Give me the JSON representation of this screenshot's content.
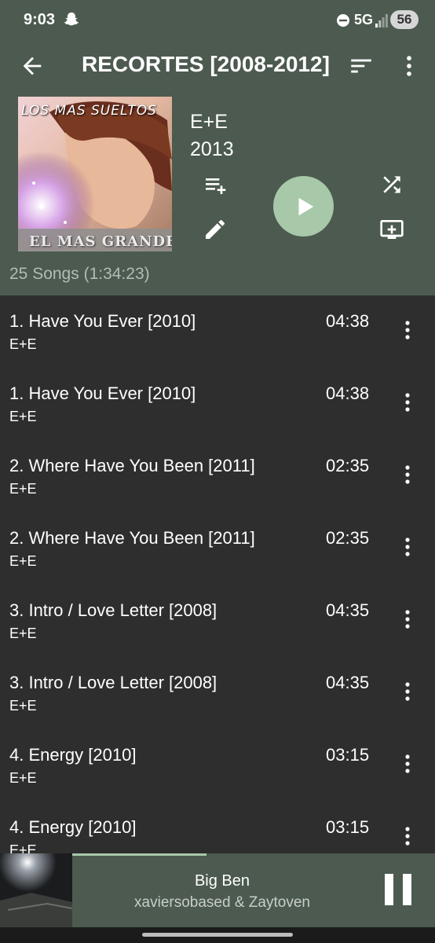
{
  "status_bar": {
    "time": "9:03",
    "network": "5G",
    "battery": "56",
    "icons": [
      "snapchat-icon",
      "do-not-disturb-icon",
      "signal-icon"
    ]
  },
  "toolbar": {
    "title": "RECORTES [2008-2012]",
    "icons": [
      "back-arrow-icon",
      "sort-icon",
      "more-vert-icon"
    ]
  },
  "album": {
    "art_text_top": "LOS MAS SUELTOS",
    "art_text_bottom": "EL MAS GRANDE",
    "artist": "E+E",
    "year": "2013",
    "song_count": "25 Songs (1:34:23)",
    "actions": [
      "add-to-queue-icon",
      "edit-icon",
      "play-icon",
      "shuffle-icon",
      "cast-icon"
    ]
  },
  "songs": [
    {
      "title": "1. Have You Ever [2010]",
      "artist": "E+E",
      "duration": "04:38"
    },
    {
      "title": "1. Have You Ever [2010]",
      "artist": "E+E",
      "duration": "04:38"
    },
    {
      "title": "2. Where Have You Been [2011]",
      "artist": "E+E",
      "duration": "02:35"
    },
    {
      "title": "2. Where Have You Been [2011]",
      "artist": "E+E",
      "duration": "02:35"
    },
    {
      "title": "3. Intro / Love Letter [2008]",
      "artist": "E+E",
      "duration": "04:35"
    },
    {
      "title": "3. Intro / Love Letter [2008]",
      "artist": "E+E",
      "duration": "04:35"
    },
    {
      "title": "4. Energy [2010]",
      "artist": "E+E",
      "duration": "03:15"
    },
    {
      "title": "4. Energy [2010]",
      "artist": "E+E",
      "duration": "03:15"
    }
  ],
  "now_playing": {
    "title": "Big Ben",
    "artist": "xaviersobased & Zaytoven",
    "progress": 0.37
  },
  "colors": {
    "header_bg": "#4c5a4f",
    "list_bg": "#2e2e2e",
    "accent": "#a7c8a9"
  }
}
